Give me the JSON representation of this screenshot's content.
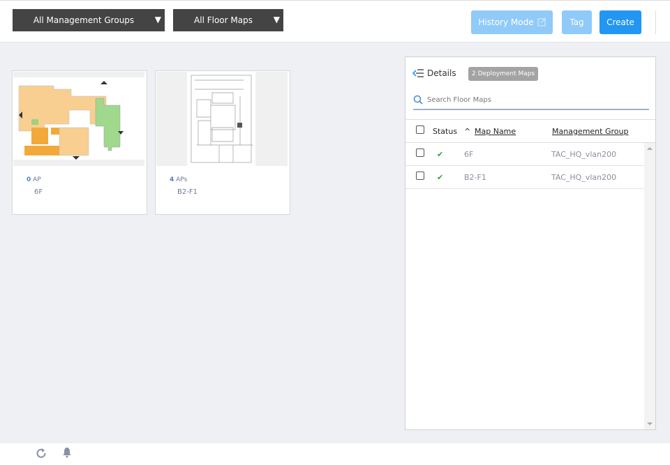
{
  "toolbar": {
    "mgmt_groups": "All Management Groups",
    "floor_maps": "All Floor Maps",
    "history_mode": "History Mode",
    "tag": "Tag",
    "create": "Create",
    "dropdown_arrow": "▼"
  },
  "cards": [
    {
      "ap_count": "0",
      "ap_label": "AP",
      "name": "6F"
    },
    {
      "ap_count": "4",
      "ap_label": "APs",
      "name": "B2-F1"
    }
  ],
  "panel": {
    "details_label": "Details",
    "badge": "2 Deployment Maps",
    "search_placeholder": "Search Floor Maps",
    "columns": {
      "status": "Status",
      "sort_icon": "^",
      "map_name": "Map Name",
      "mgmt_group": "Management Group"
    },
    "rows": [
      {
        "name": "6F",
        "group": "TAC_HQ_vlan200",
        "status": "ok"
      },
      {
        "name": "B2-F1",
        "group": "TAC_HQ_vlan200",
        "status": "ok"
      }
    ]
  },
  "colors": {
    "accent": "#2196f3",
    "accent_disabled": "#90caf9",
    "check": "#2e9e44"
  }
}
